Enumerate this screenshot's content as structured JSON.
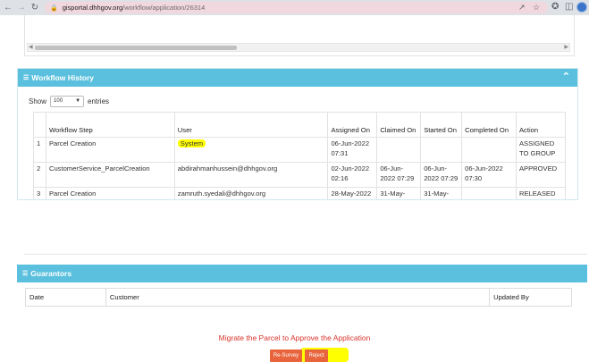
{
  "browser": {
    "url_host": "gisportal.dhhgov.org",
    "url_path": "/workflow/application/26314",
    "icons": [
      "back-icon",
      "forward-icon",
      "reload-icon",
      "lock-icon",
      "share-icon",
      "star-icon",
      "extensions-icon",
      "sidepanel-icon",
      "profile-avatar"
    ]
  },
  "workflow": {
    "title": "Workflow History",
    "show_label": "Show",
    "entries_value": "100",
    "entries_label": "entries",
    "columns": [
      "",
      "Workflow Step",
      "User",
      "Assigned On",
      "Claimed On",
      "Started On",
      "Completed On",
      "Action"
    ],
    "rows": [
      {
        "num": "1",
        "step": "Parcel Creation",
        "user": "System",
        "assigned": "06-Jun-2022 07:31",
        "claimed": "",
        "started": "",
        "completed": "",
        "action": "ASSIGNED TO GROUP"
      },
      {
        "num": "2",
        "step": "CustomerService_ParcelCreation",
        "user": "abdirahmanhussein@dhhgov.org",
        "assigned": "02-Jun-2022 02:16",
        "claimed": "06-Jun-2022 07:29",
        "started": "06-Jun-2022 07:29",
        "completed": "06-Jun-2022 07:30",
        "action": "APPROVED"
      },
      {
        "num": "3",
        "step": "Parcel Creation",
        "user": "zamruth.syedali@dhhgov.org",
        "assigned": "28-May-2022",
        "claimed": "31-May-",
        "started": "31-May-",
        "completed": "",
        "action": "RELEASED"
      }
    ]
  },
  "guarantors": {
    "title": "Guarantors",
    "columns": [
      "Date",
      "Customer",
      "Updated By"
    ]
  },
  "footer": {
    "message": "Migrate the Parcel to Approve the Application",
    "resurvey_label": "Re-Survey",
    "reject_label": "Reject"
  },
  "colors": {
    "panel_header": "#5bc0de",
    "approved": "#3cb371",
    "message": "#d9342b",
    "button": "#e8643c",
    "highlight": "#ffff00"
  }
}
